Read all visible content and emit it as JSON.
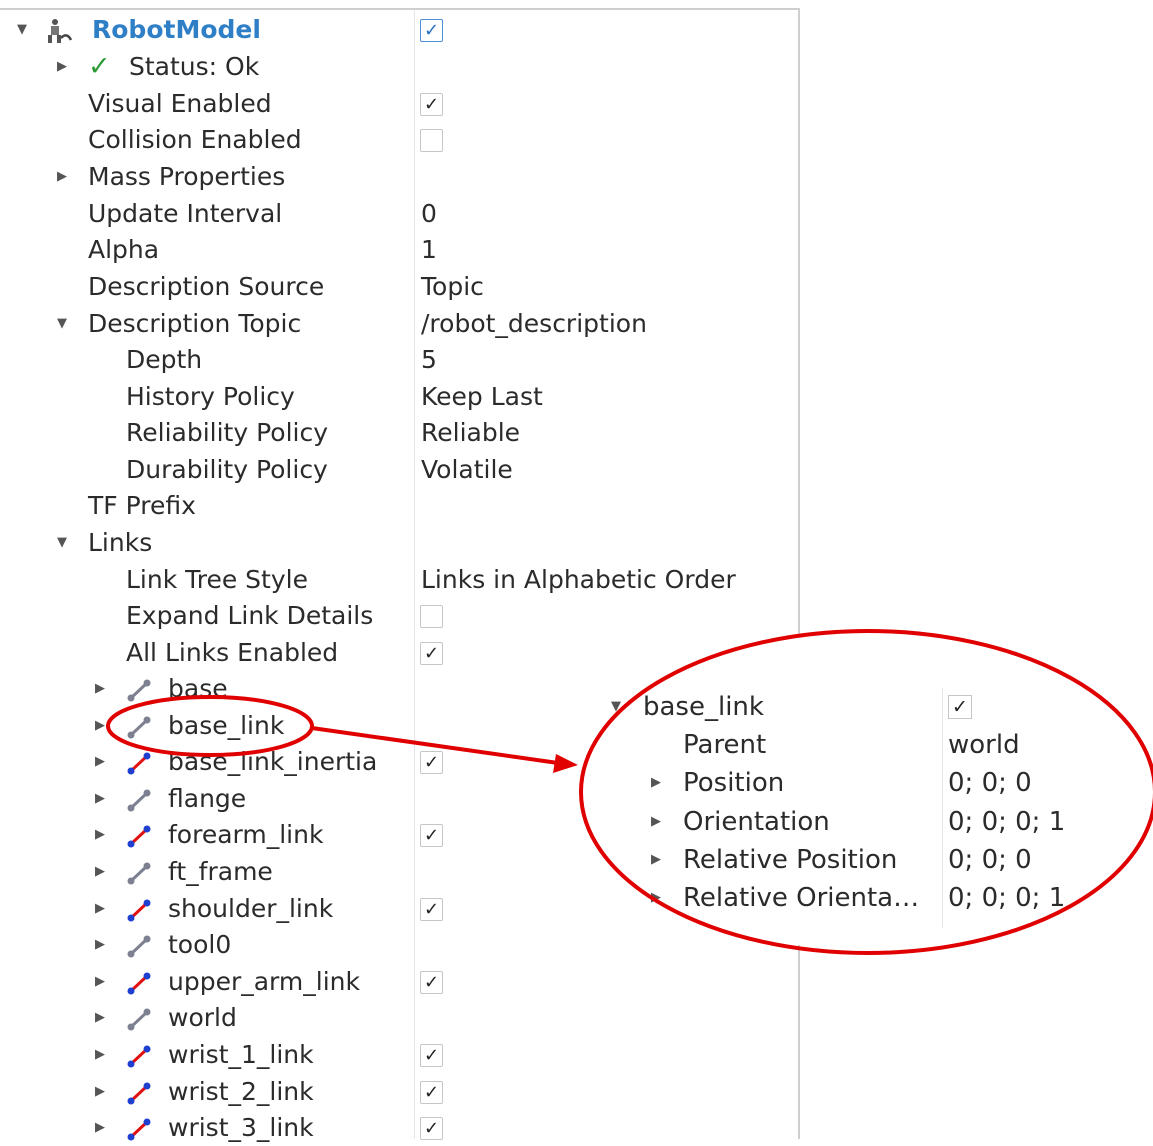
{
  "tree": {
    "root": {
      "title": "RobotModel",
      "checked": true
    },
    "status": {
      "label": "Status: Ok"
    },
    "properties": [
      {
        "label": "Visual Enabled",
        "checked": true
      },
      {
        "label": "Collision Enabled",
        "checked": false
      },
      {
        "label": "Mass Properties"
      },
      {
        "label": "Update Interval",
        "value": "0"
      },
      {
        "label": "Alpha",
        "value": "1"
      },
      {
        "label": "Description Source",
        "value": "Topic"
      },
      {
        "label": "Description Topic",
        "value": "/robot_description"
      }
    ],
    "topic_children": [
      {
        "label": "Depth",
        "value": "5"
      },
      {
        "label": "History Policy",
        "value": "Keep Last"
      },
      {
        "label": "Reliability Policy",
        "value": "Reliable"
      },
      {
        "label": "Durability Policy",
        "value": "Volatile"
      }
    ],
    "tf_prefix": {
      "label": "TF Prefix"
    },
    "links_group": {
      "label": "Links"
    },
    "link_settings": [
      {
        "label": "Link Tree Style",
        "value": "Links in Alphabetic Order"
      },
      {
        "label": "Expand Link Details",
        "checked": false
      },
      {
        "label": "All Links Enabled",
        "checked": true
      }
    ],
    "links": [
      {
        "name": "base",
        "checked": null
      },
      {
        "name": "base_link",
        "checked": null
      },
      {
        "name": "base_link_inertia",
        "checked": true
      },
      {
        "name": "flange",
        "checked": null
      },
      {
        "name": "forearm_link",
        "checked": true
      },
      {
        "name": "ft_frame",
        "checked": null
      },
      {
        "name": "shoulder_link",
        "checked": true
      },
      {
        "name": "tool0",
        "checked": null
      },
      {
        "name": "upper_arm_link",
        "checked": true
      },
      {
        "name": "world",
        "checked": null
      },
      {
        "name": "wrist_1_link",
        "checked": true
      },
      {
        "name": "wrist_2_link",
        "checked": true
      },
      {
        "name": "wrist_3_link",
        "checked": true
      }
    ]
  },
  "detail": {
    "title": "base_link",
    "checked": true,
    "rows": [
      {
        "label": "Parent",
        "value": "world"
      },
      {
        "label": "Position",
        "value": "0; 0; 0"
      },
      {
        "label": "Orientation",
        "value": "0; 0; 0; 1"
      },
      {
        "label": "Relative Position",
        "value": "0; 0; 0"
      },
      {
        "label": "Relative Orienta…",
        "value": "0; 0; 0; 1"
      }
    ]
  },
  "colors": {
    "annotation": "#e00000",
    "link_enabled": "#1f3fd1",
    "link_enabled_joint": "#e01010",
    "link_disabled": "#7d8090",
    "title": "#2f7fc7",
    "status_ok": "#2e9a36"
  },
  "icons": {
    "robot": "robot-model-icon",
    "link": "link-icon",
    "check": "checkmark-icon"
  }
}
